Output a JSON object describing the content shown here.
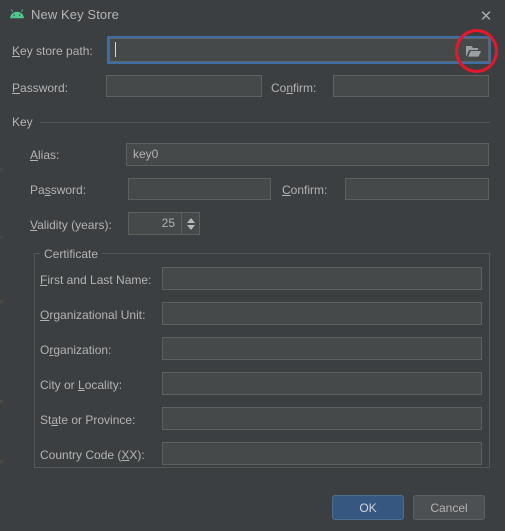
{
  "window": {
    "title": "New Key Store",
    "app_icon": "android-icon",
    "close_label": "✕"
  },
  "keystore": {
    "path_label_pre": "K",
    "path_label_post": "ey store path:",
    "path_value": "",
    "browse_icon": "folder-open-icon",
    "password_label_pre": "P",
    "password_label_post": "assword:",
    "password_value": "",
    "confirm_label_pre": "Co",
    "confirm_label_mid": "n",
    "confirm_label_post": "firm:",
    "confirm_value": ""
  },
  "key_group": {
    "title": "Key",
    "alias_label_pre": "A",
    "alias_label_post": "lias:",
    "alias_value": "key0",
    "password_label_pre": "Pa",
    "password_label_mid": "s",
    "password_label_post": "sword:",
    "password_value": "",
    "confirm_label_pre": "",
    "confirm_label_mid": "C",
    "confirm_label_post": "onfirm:",
    "confirm_value": "",
    "validity_label_pre": "V",
    "validity_label_post": "alidity (years):",
    "validity_value": "25"
  },
  "certificate": {
    "title": "Certificate",
    "fields": [
      {
        "label_pre": "",
        "label_mid": "F",
        "label_post": "irst and Last Name:",
        "value": "",
        "name": "first-and-last-name"
      },
      {
        "label_pre": "",
        "label_mid": "O",
        "label_post": "rganizational Unit:",
        "value": "",
        "name": "organizational-unit"
      },
      {
        "label_pre": "O",
        "label_mid": "r",
        "label_post": "ganization:",
        "value": "",
        "name": "organization"
      },
      {
        "label_pre": "City or ",
        "label_mid": "L",
        "label_post": "ocality:",
        "value": "",
        "name": "city-or-locality"
      },
      {
        "label_pre": "St",
        "label_mid": "a",
        "label_post": "te or Province:",
        "value": "",
        "name": "state-or-province"
      },
      {
        "label_pre": "Country Code (",
        "label_mid": "X",
        "label_post": "X):",
        "value": "",
        "name": "country-code"
      }
    ]
  },
  "buttons": {
    "ok": "OK",
    "cancel": "Cancel"
  },
  "colors": {
    "dialog_bg": "#3c3f41",
    "field_bg": "#45494a",
    "focus_border": "#3c6ea5",
    "ok_button": "#365880",
    "annotation": "#e8162a",
    "android_green": "#4fc68a"
  }
}
